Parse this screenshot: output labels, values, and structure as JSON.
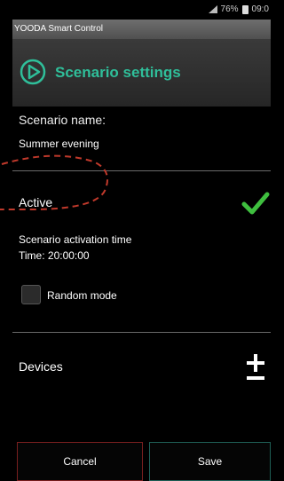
{
  "status_bar": {
    "battery_percent": "76%",
    "time": "09:0"
  },
  "app": {
    "title": "YOODA Smart Control"
  },
  "header": {
    "title": "Scenario settings",
    "accent_color": "#2fbf9a"
  },
  "scenario": {
    "name_label": "Scenario name:",
    "name_value": "Summer evening",
    "active_label": "Active",
    "active_checked": true,
    "activation_label": "Scenario activation time",
    "time_value": "Time: 20:00:00"
  },
  "random_mode": {
    "label": "Random mode",
    "checked": false
  },
  "devices": {
    "label": "Devices",
    "icon": "plus-minus-icon"
  },
  "buttons": {
    "cancel": "Cancel",
    "save": "Save"
  },
  "colors": {
    "check": "#3fbf3f",
    "annotation": "#c0392b"
  }
}
